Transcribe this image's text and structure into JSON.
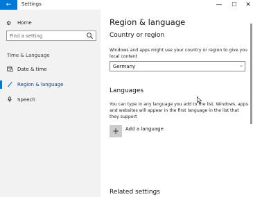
{
  "window": {
    "title": "Settings",
    "back_glyph": "←",
    "minimize_glyph": "—",
    "maximize_glyph": "☐",
    "close_glyph": "✕"
  },
  "sidebar": {
    "home": {
      "label": "Home",
      "icon": "gear-icon"
    },
    "search": {
      "placeholder": "Find a setting",
      "icon": "search-icon"
    },
    "section_label": "Time & Language",
    "items": [
      {
        "label": "Date & time",
        "icon": "calendar-clock-icon",
        "active": false
      },
      {
        "label": "Region & language",
        "icon": "pen-icon",
        "active": true
      },
      {
        "label": "Speech",
        "icon": "microphone-icon",
        "active": false
      }
    ]
  },
  "main": {
    "title": "Region & language",
    "country_heading": "Country or region",
    "country_text": "Windows and apps might use your country or region to give you local content",
    "country_value": "Germany",
    "languages_heading": "Languages",
    "languages_text": "You can type in any language you add to the list. Windows, apps and websites will appear in the first language in the list that they support",
    "add_language_label": "Add a language",
    "related_heading": "Related settings"
  },
  "colors": {
    "accent": "#0078d7",
    "sidebar_bg": "#f2f2f2"
  }
}
